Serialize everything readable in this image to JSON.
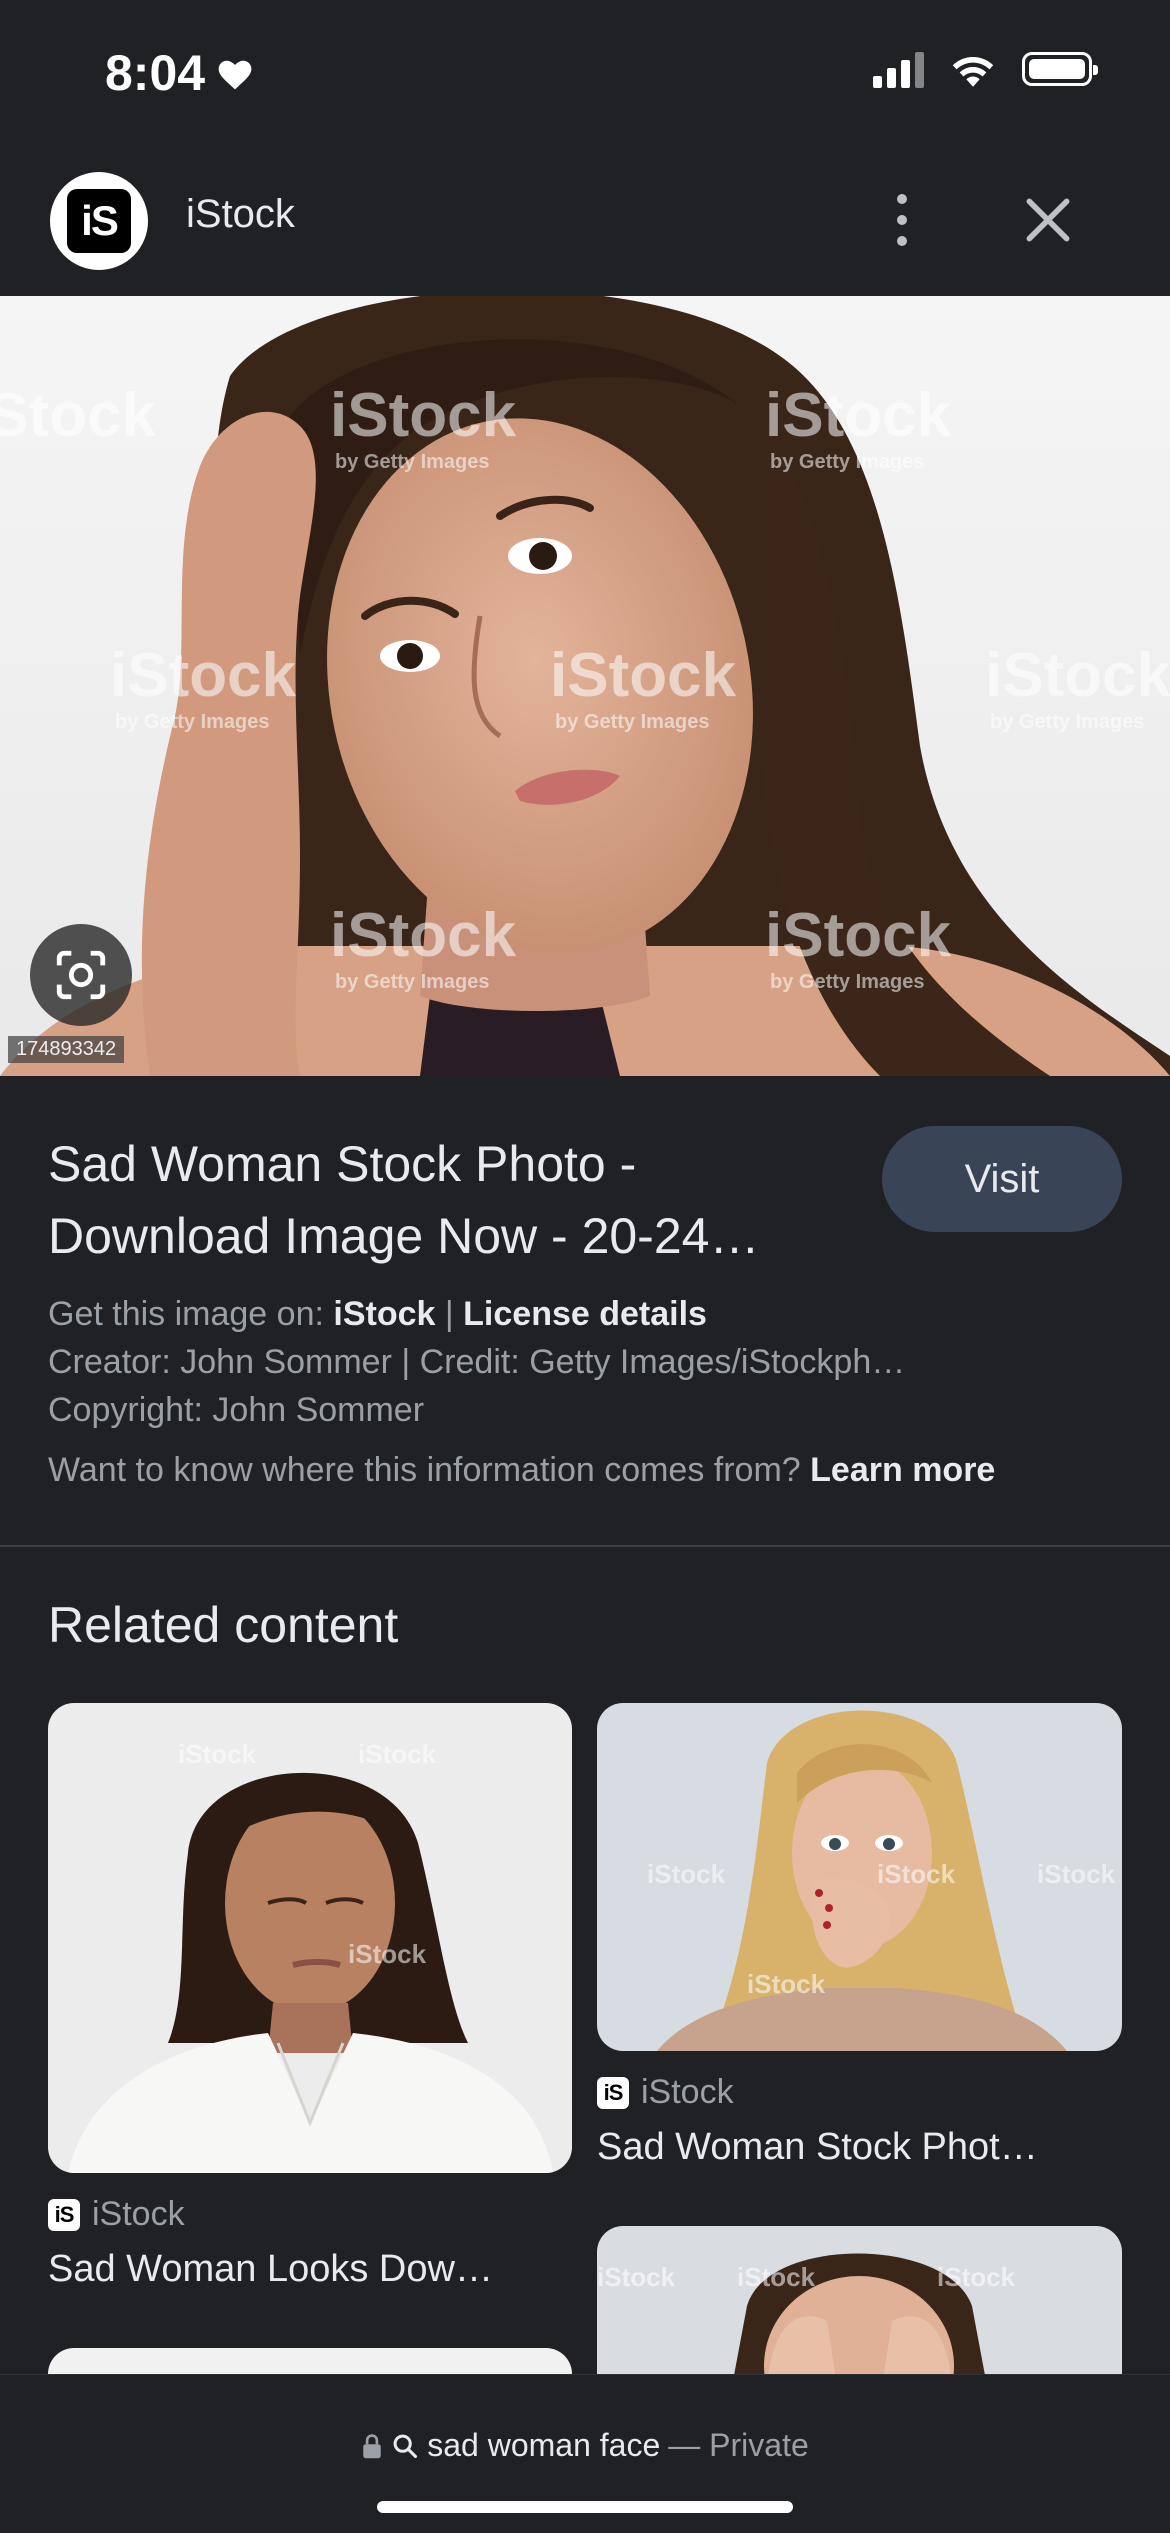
{
  "status_bar": {
    "time": "8:04"
  },
  "header": {
    "logo_text": "iS",
    "site_name": "iStock"
  },
  "hero": {
    "image_id": "174893342",
    "watermark": "iStock",
    "watermark_sub": "by Getty Images"
  },
  "result": {
    "title": "Sad Woman Stock Photo - Download Image Now - 20-24…",
    "visit_label": "Visit",
    "get_prefix": "Get this image on:",
    "get_source": "iStock",
    "license_label": "License details",
    "creator_line": "Creator: John Sommer | Credit: Getty Images/iStockph…",
    "copyright_line": "Copyright: John Sommer",
    "info_question": "Want to know where this information comes from?",
    "learn_more": "Learn more"
  },
  "related": {
    "heading": "Related content",
    "items": [
      {
        "source": "iStock",
        "title": "Sad Woman Looks Dow…"
      },
      {
        "source": "iStock",
        "title": "Sad Woman Stock Phot…"
      }
    ]
  },
  "bottom_bar": {
    "query": "sad woman face",
    "mode": "— Private"
  }
}
